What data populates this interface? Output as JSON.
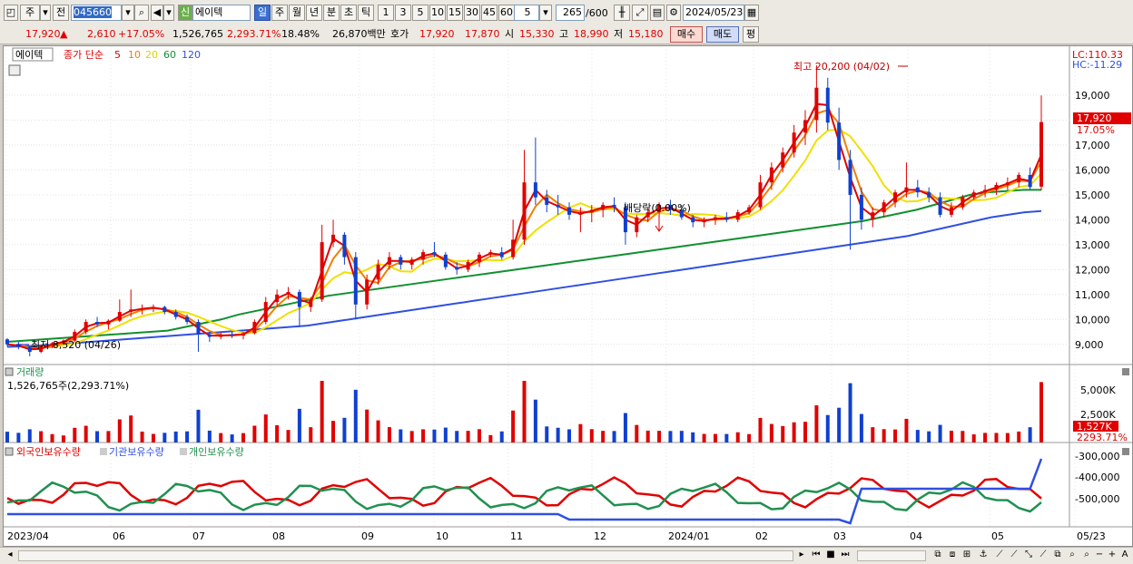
{
  "toolbar": {
    "type_label": "주",
    "jeon_label": "전",
    "code_value": "045660",
    "market_badge": "신",
    "stock_name": "에이텍",
    "periods": [
      "일",
      "주",
      "월",
      "년",
      "분",
      "초",
      "틱"
    ],
    "active_period": "일",
    "intervals": [
      "1",
      "3",
      "5",
      "10",
      "15",
      "30",
      "45",
      "60"
    ],
    "interval_value": "5",
    "count_value": "265",
    "count_max": "/600",
    "date_value": "2024/05/23"
  },
  "quote": {
    "price": "17,920",
    "change_arrow": "▲",
    "change": "2,610",
    "change_pct": "+17.05%",
    "volume": "1,526,765",
    "volume_ratio": "2,293.71%",
    "turnover": "18.48%",
    "amount": "26,870백만",
    "hoga_label": "호가",
    "ask": "17,920",
    "bid": "17,870",
    "open_label": "시",
    "open": "15,330",
    "high_label": "고",
    "high": "18,990",
    "low_label": "저",
    "low": "15,180",
    "buy_label": "매수",
    "sell_label": "매도",
    "avg_label": "평"
  },
  "price_panel": {
    "title_badge": "에이텍",
    "ma_label": "종가 단순",
    "ma_periods": [
      "5",
      "10",
      "20",
      "60",
      "120"
    ],
    "lc_label": "LC:110.33",
    "hc_label": "HC:-11.29",
    "high_annotation": "최고 20,200 (04/02)",
    "low_annotation": "최저 8,520 (04/26)",
    "dividend_annotation": "배당락(0.00%)",
    "last_price_tag": "17,920",
    "last_pct_tag": "17.05%",
    "y_ticks": [
      "19,000",
      "18,000",
      "17,000",
      "16,000",
      "15,000",
      "14,000",
      "13,000",
      "12,000",
      "11,000",
      "10,000",
      "9,000"
    ]
  },
  "volume_panel": {
    "title": "거래량",
    "value_label": "1,526,765주(2,293.71%)",
    "y_ticks": [
      "5,000K",
      "2,500K"
    ],
    "last_tag": "1,527K",
    "last_pct_tag": "2293.71%"
  },
  "holding_panel": {
    "legend": [
      "외국인보유수량",
      "기관보유수량",
      "개인보유수량"
    ],
    "y_ticks": [
      "-300,000",
      "-400,000",
      "-500,000"
    ]
  },
  "x_axis": [
    "2023/04",
    "06",
    "07",
    "08",
    "09",
    "10",
    "11",
    "12",
    "2024/01",
    "02",
    "03",
    "04",
    "05",
    "05/23"
  ],
  "colors": {
    "ma5": "#e00000",
    "ma10": "#f08000",
    "ma20": "#f0e000",
    "ma60": "#109030",
    "ma120": "#3050e0",
    "up": "#e00000",
    "down": "#1040d0",
    "foreign": "#e00000",
    "institution": "#3050e0",
    "individual": "#209050"
  },
  "chart_data": {
    "type": "candlestick",
    "price_range": [
      8300,
      20600
    ],
    "candles_ohlc": [
      [
        9200,
        9250,
        8900,
        9000
      ],
      [
        9000,
        9100,
        8800,
        8900
      ],
      [
        8900,
        8950,
        8520,
        8700
      ],
      [
        8700,
        9000,
        8650,
        8950
      ],
      [
        8950,
        9100,
        8850,
        9050
      ],
      [
        9050,
        9200,
        9000,
        9150
      ],
      [
        9150,
        9600,
        9100,
        9500
      ],
      [
        9500,
        10000,
        9400,
        9900
      ],
      [
        9900,
        10100,
        9700,
        9800
      ],
      [
        9800,
        10000,
        9600,
        9950
      ],
      [
        9950,
        10800,
        9900,
        10300
      ],
      [
        10300,
        11200,
        10100,
        10400
      ],
      [
        10400,
        10600,
        10200,
        10450
      ],
      [
        10450,
        10600,
        10300,
        10500
      ],
      [
        10500,
        10550,
        10200,
        10300
      ],
      [
        10300,
        10400,
        10000,
        10100
      ],
      [
        10100,
        10200,
        9800,
        9900
      ],
      [
        9900,
        10000,
        8700,
        9400
      ],
      [
        9400,
        9500,
        9100,
        9300
      ],
      [
        9300,
        9500,
        9200,
        9400
      ],
      [
        9400,
        9500,
        9250,
        9350
      ],
      [
        9350,
        9500,
        9200,
        9450
      ],
      [
        9450,
        10000,
        9400,
        9900
      ],
      [
        9900,
        10900,
        9800,
        10700
      ],
      [
        10700,
        11200,
        10500,
        11000
      ],
      [
        11000,
        11300,
        10800,
        11100
      ],
      [
        11100,
        11200,
        9700,
        10500
      ],
      [
        10500,
        10900,
        10300,
        10800
      ],
      [
        10800,
        13800,
        10700,
        13100
      ],
      [
        13100,
        14000,
        12900,
        13400
      ],
      [
        13400,
        13500,
        12200,
        12500
      ],
      [
        12500,
        12700,
        10000,
        10600
      ],
      [
        10600,
        11800,
        10400,
        11600
      ],
      [
        11600,
        12400,
        11400,
        12200
      ],
      [
        12200,
        12700,
        12000,
        12500
      ],
      [
        12500,
        12600,
        12000,
        12200
      ],
      [
        12200,
        12500,
        12000,
        12400
      ],
      [
        12400,
        12800,
        12200,
        12700
      ],
      [
        12700,
        13100,
        12500,
        12600
      ],
      [
        12600,
        12700,
        12000,
        12100
      ],
      [
        12100,
        12300,
        11800,
        12000
      ],
      [
        12000,
        12400,
        11900,
        12300
      ],
      [
        12300,
        12700,
        12100,
        12600
      ],
      [
        12600,
        12800,
        12500,
        12700
      ],
      [
        12700,
        12900,
        12400,
        12500
      ],
      [
        12500,
        14000,
        12400,
        13200
      ],
      [
        13200,
        16800,
        13000,
        15500
      ],
      [
        15500,
        17300,
        14600,
        14900
      ],
      [
        14900,
        15200,
        14300,
        14600
      ],
      [
        14600,
        15000,
        14200,
        14500
      ],
      [
        14500,
        14700,
        14000,
        14200
      ],
      [
        14200,
        14500,
        13500,
        14300
      ],
      [
        14300,
        14600,
        13900,
        14400
      ],
      [
        14400,
        14700,
        14100,
        14600
      ],
      [
        14600,
        14900,
        14300,
        14500
      ],
      [
        14500,
        14700,
        13000,
        13500
      ],
      [
        13500,
        14200,
        13300,
        14100
      ],
      [
        14100,
        14500,
        13900,
        14300
      ],
      [
        14300,
        14700,
        14100,
        14600
      ],
      [
        14600,
        14800,
        14200,
        14400
      ],
      [
        14400,
        14600,
        14000,
        14100
      ],
      [
        14100,
        14200,
        13700,
        13900
      ],
      [
        13900,
        14100,
        13700,
        14000
      ],
      [
        14000,
        14200,
        13800,
        14100
      ],
      [
        14100,
        14300,
        13900,
        14000
      ],
      [
        14000,
        14400,
        13900,
        14300
      ],
      [
        14300,
        14600,
        14200,
        14500
      ],
      [
        14500,
        15800,
        14400,
        15500
      ],
      [
        15500,
        16300,
        15200,
        16100
      ],
      [
        16100,
        16900,
        15900,
        16700
      ],
      [
        16700,
        17800,
        16500,
        17500
      ],
      [
        17500,
        18400,
        17000,
        18000
      ],
      [
        18000,
        20200,
        17500,
        19300
      ],
      [
        19300,
        19700,
        17600,
        17900
      ],
      [
        17900,
        18500,
        16000,
        16400
      ],
      [
        16400,
        16800,
        12800,
        15000
      ],
      [
        15000,
        15300,
        13600,
        14000
      ],
      [
        14000,
        14500,
        13700,
        14300
      ],
      [
        14300,
        14800,
        14100,
        14700
      ],
      [
        14700,
        15200,
        14500,
        15100
      ],
      [
        15100,
        16300,
        14900,
        15300
      ],
      [
        15300,
        15600,
        14900,
        15100
      ],
      [
        15100,
        15300,
        14700,
        14900
      ],
      [
        14900,
        15100,
        14100,
        14200
      ],
      [
        14200,
        14700,
        14100,
        14500
      ],
      [
        14500,
        15000,
        14400,
        14900
      ],
      [
        14900,
        15200,
        14800,
        15100
      ],
      [
        15100,
        15400,
        14900,
        15200
      ],
      [
        15200,
        15500,
        15000,
        15400
      ],
      [
        15400,
        15700,
        15200,
        15500
      ],
      [
        15500,
        15900,
        15300,
        15800
      ],
      [
        15800,
        16100,
        15200,
        15310
      ],
      [
        15330,
        18990,
        15180,
        17920
      ]
    ],
    "ma60": [
      9100,
      9150,
      9200,
      9250,
      9300,
      9350,
      9400,
      9450,
      9500,
      9550,
      9700,
      9850,
      10000,
      10200,
      10350,
      10500,
      10650,
      10800,
      10950,
      11050,
      11150,
      11250,
      11350,
      11450,
      11550,
      11650,
      11750,
      11850,
      11950,
      12050,
      12150,
      12250,
      12350,
      12450,
      12550,
      12650,
      12750,
      12850,
      12950,
      13050,
      13150,
      13250,
      13350,
      13450,
      13550,
      13650,
      13750,
      13850,
      13950,
      14100,
      14250,
      14400,
      14600,
      14800,
      15000,
      15100,
      15150,
      15200,
      15200
    ],
    "ma120": [
      8900,
      8920,
      8950,
      9000,
      9050,
      9100,
      9150,
      9200,
      9250,
      9300,
      9350,
      9400,
      9450,
      9500,
      9550,
      9600,
      9650,
      9700,
      9750,
      9850,
      9950,
      10050,
      10150,
      10250,
      10350,
      10450,
      10550,
      10650,
      10750,
      10850,
      10950,
      11050,
      11150,
      11250,
      11350,
      11450,
      11550,
      11650,
      11750,
      11850,
      11950,
      12050,
      12150,
      12250,
      12350,
      12450,
      12550,
      12650,
      12750,
      12850,
      12950,
      13050,
      13150,
      13250,
      13350,
      13500,
      13650,
      13800,
      13950,
      14100,
      14200,
      14300,
      14350
    ]
  }
}
